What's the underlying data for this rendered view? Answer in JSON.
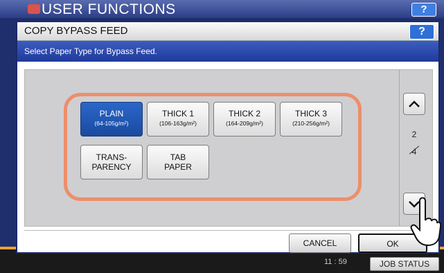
{
  "background": {
    "title": "USER FUNCTIONS",
    "help": "?",
    "time": "11 : 59",
    "job_status": "JOB STATUS"
  },
  "dialog": {
    "title": "COPY BYPASS FEED",
    "help": "?",
    "message": "Select Paper Type for Bypass Feed.",
    "paper_types": [
      {
        "name": "PLAIN",
        "range": "(64-105g/m²)",
        "selected": true
      },
      {
        "name": "THICK 1",
        "range": "(106-163g/m²)",
        "selected": false
      },
      {
        "name": "THICK 2",
        "range": "(164-209g/m²)",
        "selected": false
      },
      {
        "name": "THICK 3",
        "range": "(210-256g/m²)",
        "selected": false
      },
      {
        "name": "TRANS-\nPARENCY",
        "selected": false
      },
      {
        "name": "TAB\nPAPER",
        "selected": false
      }
    ],
    "page": {
      "current": "2",
      "total": "4"
    },
    "cancel": "CANCEL",
    "ok": "OK"
  },
  "colors": {
    "selected": "#1f56b4",
    "highlight": "#ec8f6b",
    "title_bar": "#2b3d86"
  }
}
